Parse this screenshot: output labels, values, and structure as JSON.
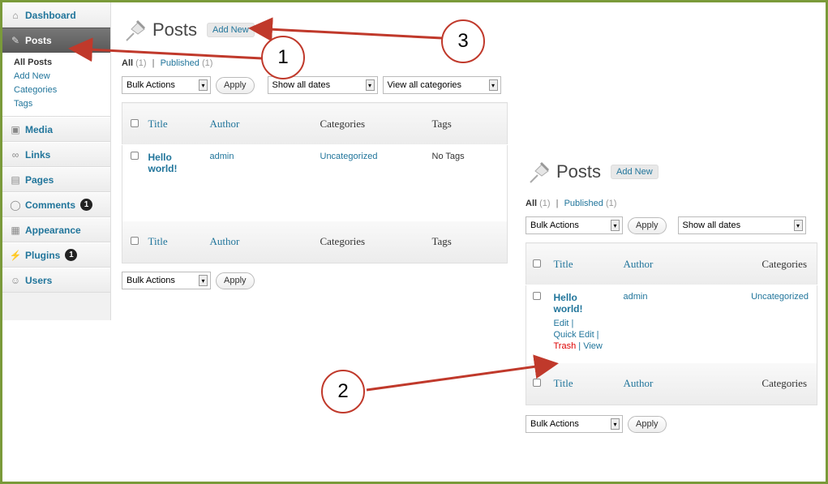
{
  "sidebar": {
    "dashboard": "Dashboard",
    "posts": "Posts",
    "submenu": [
      "All Posts",
      "Add New",
      "Categories",
      "Tags"
    ],
    "media": "Media",
    "links": "Links",
    "pages": "Pages",
    "comments": "Comments",
    "comments_badge": "1",
    "appearance": "Appearance",
    "plugins": "Plugins",
    "plugins_badge": "1",
    "users": "Users"
  },
  "left_panel": {
    "title": "Posts",
    "add_new": "Add New",
    "filter_all": "All",
    "filter_all_count": "(1)",
    "sep": "|",
    "filter_published": "Published",
    "filter_published_count": "(1)",
    "bulk_actions": "Bulk Actions",
    "apply": "Apply",
    "dates": "Show all dates",
    "categories_filter": "View all categories",
    "columns": [
      "Title",
      "Author",
      "Categories",
      "Tags"
    ],
    "row": {
      "title": "Hello world!",
      "author": "admin",
      "category": "Uncategorized",
      "tags": "No Tags"
    },
    "bulk_actions_bottom": "Bulk Actions",
    "apply_bottom": "Apply"
  },
  "right_panel": {
    "title": "Posts",
    "add_new": "Add New",
    "filter_all": "All",
    "filter_all_count": "(1)",
    "sep": "|",
    "filter_published": "Published",
    "filter_published_count": "(1)",
    "bulk_actions": "Bulk Actions",
    "apply": "Apply",
    "dates": "Show all dates",
    "columns": [
      "Title",
      "Author",
      "Categories"
    ],
    "row": {
      "title": "Hello world!",
      "author": "admin",
      "category": "Uncategorized",
      "edit": "Edit |",
      "quick_edit": "Quick Edit |",
      "trash": "Trash",
      "view_sep": " | ",
      "view": "View"
    },
    "bulk_actions_bottom": "Bulk Actions",
    "apply_bottom": "Apply"
  },
  "callouts": [
    "1",
    "2",
    "3"
  ],
  "colors": {
    "arrow": "#c0392b",
    "frame": "#7a9a3a",
    "link": "#21759b"
  }
}
